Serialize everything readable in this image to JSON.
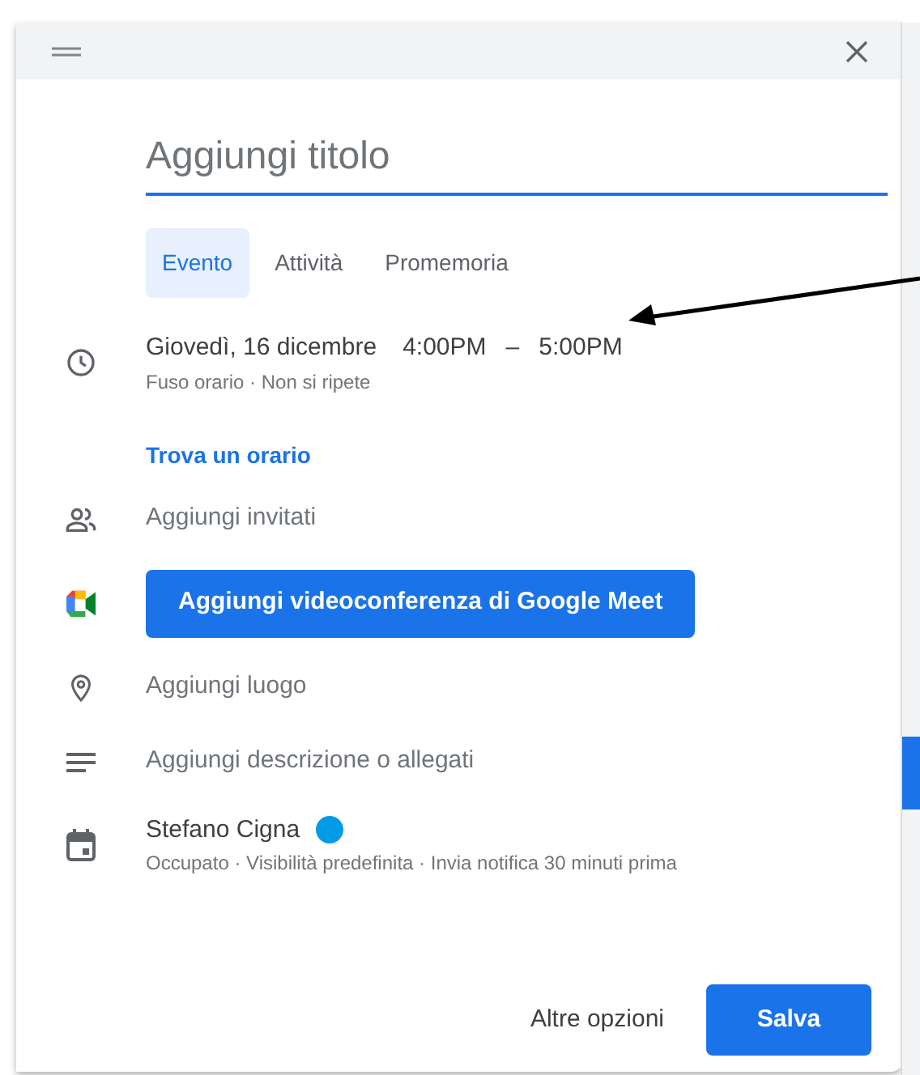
{
  "dialog": {
    "title_field": {
      "placeholder": "Aggiungi titolo"
    },
    "tabs": [
      {
        "label": "Evento",
        "selected": true
      },
      {
        "label": "Attività",
        "selected": false
      },
      {
        "label": "Promemoria",
        "selected": false
      }
    ],
    "rows": [
      {
        "kind": "time",
        "date": "Giovedì, 16 dicembre",
        "start": "4:00PM",
        "separator": "–",
        "end": "5:00PM",
        "details": "Fuso orario · Non si ripete"
      },
      {
        "kind": "link",
        "label": "Trova un orario"
      },
      {
        "kind": "guests",
        "placeholder": "Aggiungi invitati"
      },
      {
        "kind": "video",
        "label": "Aggiungi videoconferenza di Google Meet"
      },
      {
        "kind": "location",
        "placeholder": "Aggiungi luogo"
      },
      {
        "kind": "description",
        "placeholder": "Aggiungi descrizione o allegati"
      },
      {
        "kind": "calendar",
        "name": "Stefano Cigna",
        "color": "#039be5",
        "details": "Occupato · Visibilità predefinita · Invia notifica 30 minuti prima"
      }
    ],
    "footer": {
      "secondary_button": "Altre opzioni",
      "primary_button": "Salva"
    }
  }
}
